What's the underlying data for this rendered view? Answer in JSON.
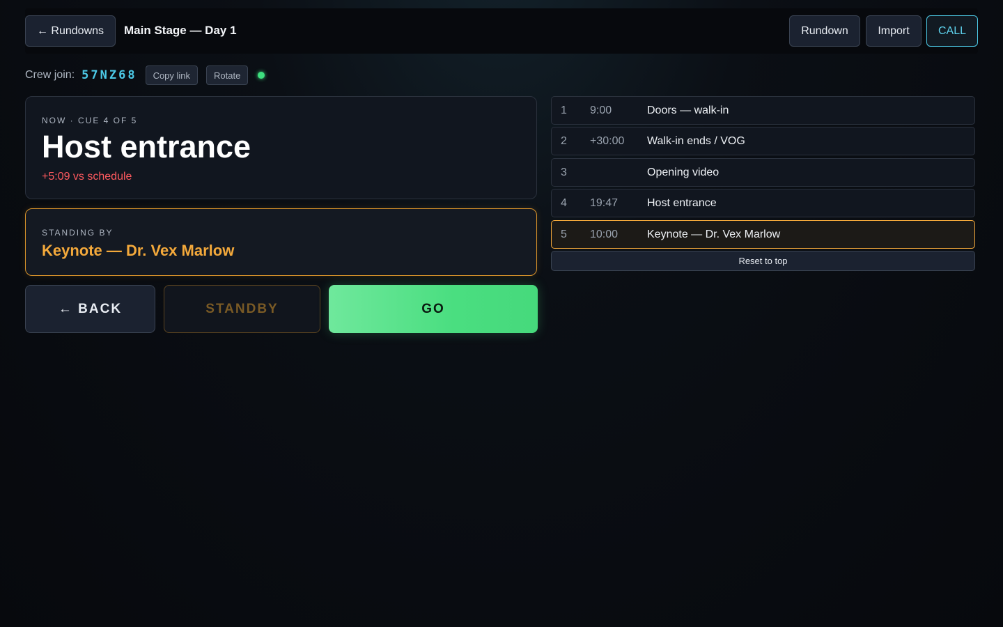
{
  "header": {
    "back_label": "← Rundowns",
    "title": "Main Stage — Day 1",
    "rundown_label": "Rundown",
    "import_label": "Import",
    "call_label": "CALL"
  },
  "crew": {
    "label": "Crew join:",
    "code": "57NZ68",
    "copy_label": "Copy link",
    "rotate_label": "Rotate",
    "status_color": "#3ee07f"
  },
  "now": {
    "eyebrow": "NOW · CUE 4 OF 5",
    "title": "Host entrance",
    "delta": "+5:09 vs schedule"
  },
  "standby": {
    "eyebrow": "STANDING BY",
    "title": "Keynote — Dr. Vex Marlow"
  },
  "controls": {
    "back_label": "← BACK",
    "standby_label": "STANDBY",
    "go_label": "GO"
  },
  "cues": [
    {
      "num": "1",
      "time": "9:00",
      "name": "Doors — walk-in"
    },
    {
      "num": "2",
      "time": "+30:00",
      "name": "Walk-in ends / VOG"
    },
    {
      "num": "3",
      "time": "",
      "name": "Opening video"
    },
    {
      "num": "4",
      "time": "19:47",
      "name": "Host entrance"
    },
    {
      "num": "5",
      "time": "10:00",
      "name": "Keynote — Dr. Vex Marlow"
    }
  ],
  "reset_label": "Reset to top",
  "colors": {
    "accent": "#4cc9e6",
    "standby": "#f4a93b",
    "go": "#4ade80",
    "late": "#ff5a5f"
  }
}
